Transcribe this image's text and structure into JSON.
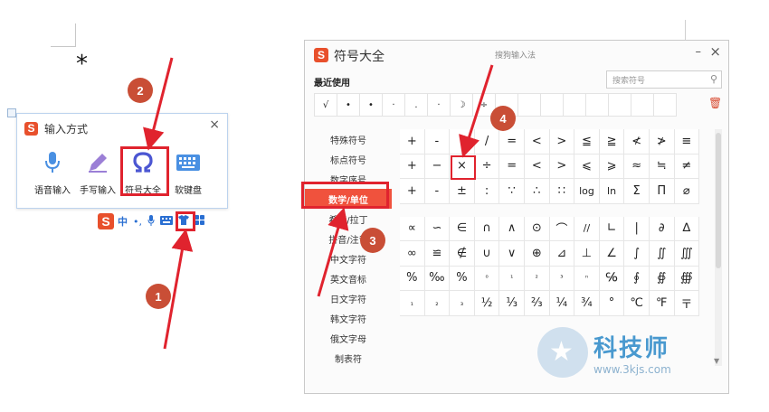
{
  "doc": {
    "asterisk": "*"
  },
  "ime_popup": {
    "title": "输入方式",
    "close": "×",
    "items": [
      {
        "label": "语音输入",
        "icon": "microphone-icon"
      },
      {
        "label": "手写输入",
        "icon": "pen-icon"
      },
      {
        "label": "符号大全",
        "icon": "omega-icon"
      },
      {
        "label": "软键盘",
        "icon": "keyboard-icon"
      }
    ]
  },
  "ime_bar": {
    "logo": "S",
    "lang": "中",
    "punct": "•,",
    "icons": [
      "microphone-icon",
      "keyboard-icon",
      "shirt-icon",
      "apps-icon"
    ]
  },
  "symbol_window": {
    "logo": "S",
    "title": "符号大全",
    "subtitle": "搜狗输入法",
    "min": "–",
    "close": "×",
    "recent_label": "最近使用",
    "search_placeholder": "搜索符号",
    "recent": [
      "√",
      "•",
      "•",
      "·",
      ".",
      "·",
      "☽",
      "÷"
    ],
    "categories": [
      "特殊符号",
      "标点符号",
      "数字序号",
      "数学/单位",
      "希腊/拉丁",
      "拼音/注音",
      "中文字符",
      "英文音标",
      "日文字符",
      "韩文字符",
      "俄文字母",
      "制表符"
    ],
    "active_category": "数学/单位",
    "grid_top": [
      [
        "+",
        "-",
        "•",
        "/",
        "=",
        "<",
        ">",
        "≦",
        "≧",
        "≮",
        "≯",
        "≡"
      ],
      [
        "+",
        "−",
        "×",
        "÷",
        "=",
        "<",
        ">",
        "⩽",
        "⩾",
        "≈",
        "≒",
        "≠"
      ],
      [
        "+",
        "-",
        "±",
        ":",
        "∵",
        "∴",
        "∷",
        "log",
        "ln",
        "Σ",
        "Π",
        "⌀"
      ]
    ],
    "grid_bottom": [
      [
        "∝",
        "∽",
        "∈",
        "∩",
        "∧",
        "⊙",
        "⌒",
        "//",
        "∟",
        "|",
        "∂",
        "∆"
      ],
      [
        "∞",
        "≌",
        "∉",
        "∪",
        "∨",
        "⊕",
        "⊿",
        "⊥",
        "∠",
        "∫",
        "∬",
        "∭"
      ],
      [
        "%",
        "‰",
        "%",
        "⁰",
        "¹",
        "²",
        "³",
        "ⁿ",
        "℅",
        "∮",
        "∯",
        "∰"
      ],
      [
        "₁",
        "₂",
        "₃",
        "½",
        "⅓",
        "⅔",
        "¼",
        "¾",
        "°",
        "℃",
        "℉",
        "〒"
      ]
    ]
  },
  "annotations": {
    "n1": "1",
    "n2": "2",
    "n3": "3",
    "n4": "4"
  },
  "watermark": {
    "title": "科技师",
    "url": "www.3kjs.com"
  },
  "colors": {
    "accent_red": "#e0232e",
    "badge": "#c94e36",
    "sogou": "#e8502c",
    "active_cat": "#f0523d"
  }
}
